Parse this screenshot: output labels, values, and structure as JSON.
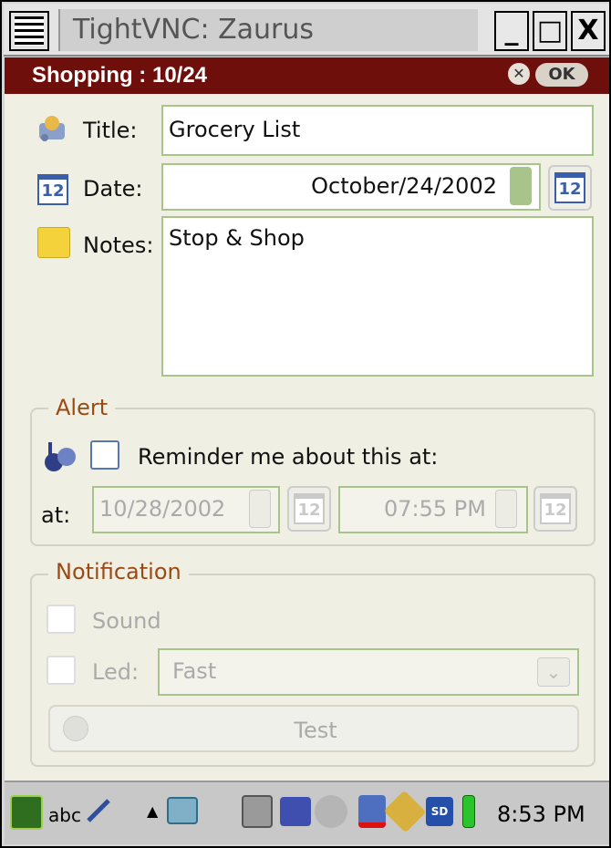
{
  "window": {
    "title": "TightVNC: Zaurus",
    "minimize_label": "_",
    "maximize_label": "□",
    "close_label": "X"
  },
  "app": {
    "title": "Shopping : 10/24",
    "close_label": "✕",
    "ok_label": "OK"
  },
  "form": {
    "title_label": "Title:",
    "title_value": "Grocery List",
    "date_label": "Date:",
    "date_value": "October/24/2002",
    "notes_label": "Notes:",
    "notes_value": "Stop & Shop",
    "calendar_day": "12"
  },
  "alert": {
    "legend": "Alert",
    "reminder_label": "Reminder me about this at:",
    "reminder_checked": false,
    "at_label": "at:",
    "date_value": "10/28/2002",
    "time_value": "07:55 PM"
  },
  "notification": {
    "legend": "Notification",
    "sound_label": "Sound",
    "led_label": "Led:",
    "led_value": "Fast",
    "test_label": "Test"
  },
  "taskbar": {
    "input_method": "abc",
    "clock": "8:53 PM"
  }
}
